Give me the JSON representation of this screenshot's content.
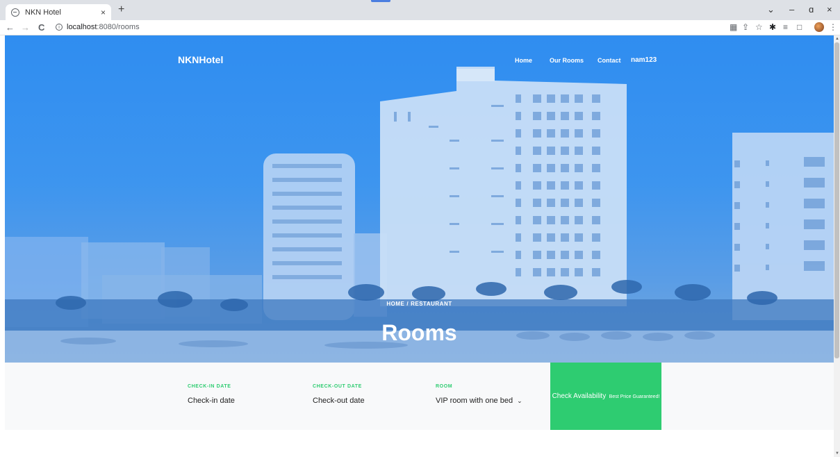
{
  "browser": {
    "tab_title": "NKN Hotel",
    "tab_close": "×",
    "new_tab": "+",
    "url_host": "localhost",
    "url_path": ":8080/rooms",
    "back": "←",
    "forward": "→",
    "reload": "C",
    "info": "i",
    "win_down": "⌄",
    "win_min": "–",
    "win_restore": "ɑ",
    "win_close": "×"
  },
  "site": {
    "brand": "NKNHotel",
    "nav": [
      {
        "label": "Home"
      },
      {
        "label": "Our Rooms"
      },
      {
        "label": "Contact"
      }
    ],
    "user": "nam123"
  },
  "hero": {
    "breadcrumb_home": "HOME",
    "breadcrumb_sep": "/",
    "breadcrumb_current": "RESTAURANT",
    "title": "Rooms"
  },
  "booking": {
    "checkin_label": "CHECK-IN DATE",
    "checkin_value": "Check-in date",
    "checkout_label": "CHECK-OUT DATE",
    "checkout_value": "Check-out date",
    "room_label": "ROOM",
    "room_value": "VIP room with one bed",
    "room_chevron": "⌄",
    "button_main": "Check Availability",
    "button_small": "Best Price Guaranteed!"
  },
  "colors": {
    "accent_green": "#2ecc71",
    "hero_blue": "#2f8df0"
  }
}
